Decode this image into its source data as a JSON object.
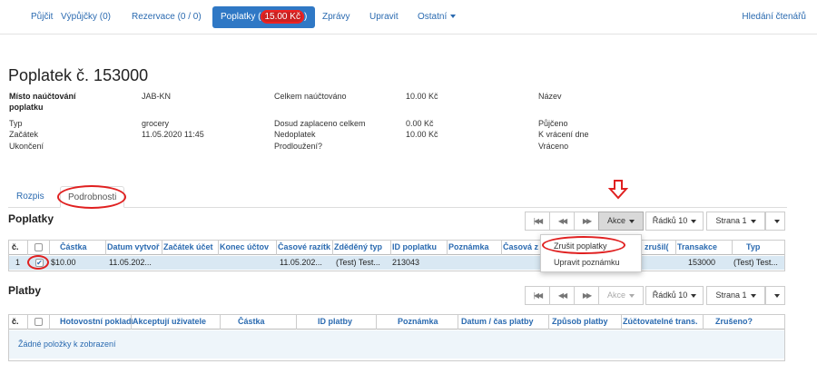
{
  "nav": {
    "tabs": [
      {
        "label": "Půjčit"
      },
      {
        "label": "Výpůjčky (0)"
      },
      {
        "label": "Rezervace (0 / 0)"
      },
      {
        "label": "Poplatky (",
        "amount": "15.00 Kč",
        "suffix": ")"
      },
      {
        "label": "Zprávy"
      },
      {
        "label": "Upravit"
      },
      {
        "label": "Ostatní"
      }
    ],
    "right_link": "Hledání čtenářů"
  },
  "page_title": "Poplatek č. 153000",
  "info": {
    "col1": [
      {
        "label": "Místo naúčtování",
        "label2": "poplatku",
        "value": "JAB-KN"
      },
      {
        "label": "Typ",
        "value": "grocery"
      },
      {
        "label": "Začátek",
        "value": "11.05.2020 11:45"
      },
      {
        "label": "Ukončení",
        "value": ""
      }
    ],
    "col2": [
      {
        "label": "Celkem naúčtováno",
        "value": "10.00 Kč"
      },
      {
        "label": "Dosud zaplaceno celkem",
        "value": "0.00 Kč"
      },
      {
        "label": "Nedoplatek",
        "value": "10.00 Kč"
      },
      {
        "label": "Prodloužení?",
        "value": ""
      }
    ],
    "col3": [
      {
        "label": "Název"
      },
      {
        "label": "Půjčeno"
      },
      {
        "label": "K vrácení dne"
      },
      {
        "label": "Vráceno"
      }
    ]
  },
  "subtabs": [
    "Rozpis",
    "Podrobnosti"
  ],
  "fees": {
    "title": "Poplatky",
    "toolbar": {
      "actions": "Akce",
      "rows": "Řádků 10",
      "page": "Strana 1"
    },
    "columns": [
      "č.",
      "Částka",
      "Datum vytvoř",
      "Začátek účet",
      "Konec účtov",
      "Časové razítk",
      "Zděděný typ",
      "ID poplatku",
      "Poznámka",
      "Časová z",
      "zrušil(",
      "Transakce",
      "Typ"
    ],
    "rows": [
      {
        "num": "1",
        "amount": "$10.00",
        "created": "11.05.202...",
        "timestamp": "11.05.202...",
        "inherited": "(Test) Test...",
        "fee_id": "213043",
        "transaction": "153000",
        "type": "(Test) Test..."
      }
    ],
    "menu": [
      "Zrušit poplatky",
      "Upravit poznámku"
    ]
  },
  "payments": {
    "title": "Platby",
    "toolbar": {
      "actions": "Akce",
      "rows": "Řádků 10",
      "page": "Strana 1"
    },
    "columns": [
      "č.",
      "Hotovostní pokladí",
      "Akceptují uživatele",
      "Částka",
      "ID platby",
      "Poznámka",
      "Datum / čas platby",
      "Způsob platby",
      "Zúčtovatelné trans.",
      "Zrušeno?"
    ],
    "empty": "Žádné položky k zobrazení"
  },
  "colors": {
    "accent": "#2f78c5",
    "link": "#2a6ab0",
    "highlight_ring": "#e02020",
    "selected_row": "#d9e8f3"
  },
  "icons": [
    "first-page-icon",
    "prev-page-icon",
    "next-page-icon",
    "caret-down-icon",
    "checkbox-icon",
    "down-arrow-annotation-icon"
  ]
}
